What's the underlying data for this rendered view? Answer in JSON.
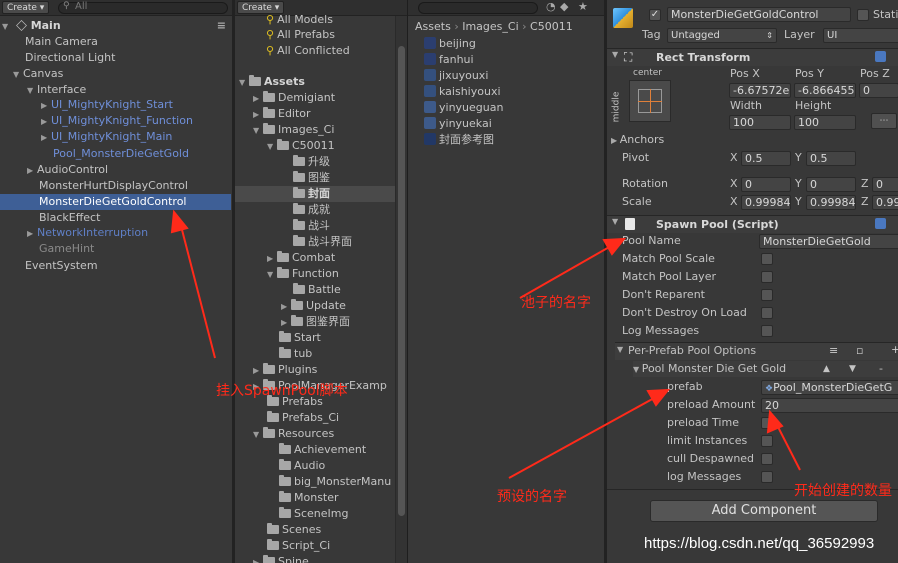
{
  "hierarchy": {
    "create_label": "Create ▾",
    "search_placeholder": "All",
    "scene_name": "Main",
    "items": [
      "Main Camera",
      "Directional Light",
      "Canvas",
      "Interface",
      "UI_MightyKnight_Start",
      "UI_MightyKnight_Function",
      "UI_MightyKnight_Main",
      "Pool_MonsterDieGetGold",
      "AudioControl",
      "MonsterHurtDisplayControl",
      "MonsterDieGetGoldControl",
      "BlackEffect",
      "NetworkInterruption",
      "GameHint",
      "EventSystem"
    ]
  },
  "project": {
    "create_label": "Create ▾",
    "favorites": [
      "All Models",
      "All Prefabs",
      "All Conflicted"
    ],
    "assets_root": "Assets",
    "tree": [
      "Demigiant",
      "Editor",
      "Images_Ci",
      "C50011",
      "升级",
      "图鉴",
      "封面",
      "成就",
      "战斗",
      "战斗界面",
      "Combat",
      "Function",
      "Battle",
      "Update",
      "图鉴界面",
      "Start",
      "tub",
      "Plugins",
      "PoolManagerExamp",
      "Prefabs",
      "Prefabs_Ci",
      "Resources",
      "Achievement",
      "Audio",
      "big_MonsterManu",
      "Monster",
      "SceneImg",
      "Scenes",
      "Script_Ci",
      "Spine"
    ],
    "breadcrumb": [
      "Assets",
      "Images_Ci",
      "C50011"
    ],
    "files": [
      "beijing",
      "fanhui",
      "jixuyouxi",
      "kaishiyouxi",
      "yinyueguan",
      "yinyuekai",
      "封面参考图"
    ]
  },
  "inspector": {
    "object_name": "MonsterDieGetGoldControl",
    "static_label": "Static",
    "tag_label": "Tag",
    "tag_value": "Untagged",
    "layer_label": "Layer",
    "layer_value": "UI",
    "rect_transform": {
      "title": "Rect Transform",
      "anchor_h": "center",
      "anchor_v": "middle",
      "pos_x_label": "Pos X",
      "pos_y_label": "Pos Y",
      "pos_z_label": "Pos Z",
      "pos_x": "-6.67572e",
      "pos_y": "-6.866455",
      "pos_z": "0",
      "width_label": "Width",
      "height_label": "Height",
      "width": "100",
      "height": "100",
      "anchors_label": "Anchors",
      "pivot_label": "Pivot",
      "pivot_x": "0.5",
      "pivot_y": "0.5",
      "rotation_label": "Rotation",
      "rot_x": "0",
      "rot_y": "0",
      "rot_z": "0",
      "scale_label": "Scale",
      "scale_x": "0.99984",
      "scale_y": "0.99984",
      "scale_z": "0.99"
    },
    "spawn_pool": {
      "title": "Spawn Pool (Script)",
      "pool_name_label": "Pool Name",
      "pool_name_value": "MonsterDieGetGold",
      "options": [
        "Match Pool Scale",
        "Match Pool Layer",
        "Don't Reparent",
        "Don't Destroy On Load",
        "Log Messages"
      ],
      "per_prefab_label": "Per-Prefab Pool Options",
      "pool_item_label": "Pool Monster Die Get Gold",
      "prefab_label": "prefab",
      "prefab_value": "Pool_MonsterDieGetG",
      "preload_amount_label": "preload Amount",
      "preload_amount_value": "20",
      "preload_time_label": "preload Time",
      "limit_instances_label": "limit Instances",
      "cull_despawned_label": "cull Despawned",
      "log_messages_label": "log Messages"
    },
    "add_component_label": "Add Component"
  },
  "annotations": {
    "attach_script": "挂入SpawnPool脚本",
    "pool_name": "池子的名字",
    "prefab_name": "预设的名字",
    "preload_count": "开始创建的数量"
  },
  "watermark": "https://blog.csdn.net/qq_36592993",
  "colors": {
    "annotation": "#ff2a1a",
    "selection": "#3e5f96",
    "prefab_blue": "#6f8fd9"
  }
}
